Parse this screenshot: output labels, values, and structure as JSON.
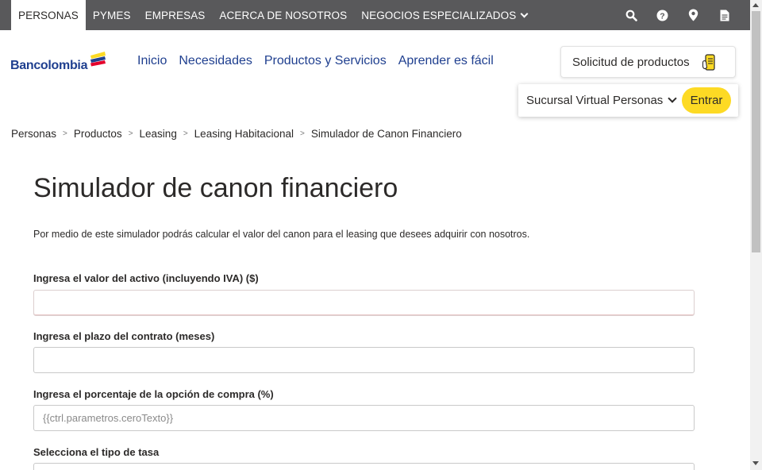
{
  "colors": {
    "topbar": "#59595b",
    "brand_blue": "#1f3f8f",
    "accent_yellow": "#fdda24",
    "text": "#2c2a29"
  },
  "topnav": {
    "items": [
      {
        "label": "PERSONAS",
        "active": true
      },
      {
        "label": "PYMES"
      },
      {
        "label": "EMPRESAS"
      },
      {
        "label": "ACERCA DE NOSOTROS"
      },
      {
        "label": "NEGOCIOS ESPECIALIZADOS"
      }
    ],
    "icons": [
      "search-icon",
      "help-icon",
      "location-pin-icon",
      "document-icon"
    ]
  },
  "logo": {
    "text": "Bancolombia"
  },
  "mainnav": {
    "items": [
      "Inicio",
      "Necesidades",
      "Productos y Servicios",
      "Aprender es fácil"
    ]
  },
  "solicitud": {
    "label": "Solicitud de productos",
    "icon": "product-request-icon"
  },
  "sucursal": {
    "label": "Sucursal Virtual Personas",
    "button": "Entrar"
  },
  "breadcrumb": [
    "Personas",
    "Productos",
    "Leasing",
    "Leasing Habitacional",
    "Simulador de Canon Financiero"
  ],
  "page": {
    "title": "Simulador de canon financiero",
    "description": "Por medio de este simulador podrás calcular el valor del canon para el leasing que desees adquirir con nosotros."
  },
  "form": {
    "valor_label": "Ingresa el valor del activo (incluyendo IVA) ($)",
    "valor_value": "",
    "plazo_label": "Ingresa el plazo del contrato (meses)",
    "plazo_value": "",
    "opcion_label": "Ingresa el porcentaje de la opción de compra (%)",
    "opcion_placeholder": "{{ctrl.parametros.ceroTexto}}",
    "tasa_label": "Selecciona el tipo de tasa"
  }
}
